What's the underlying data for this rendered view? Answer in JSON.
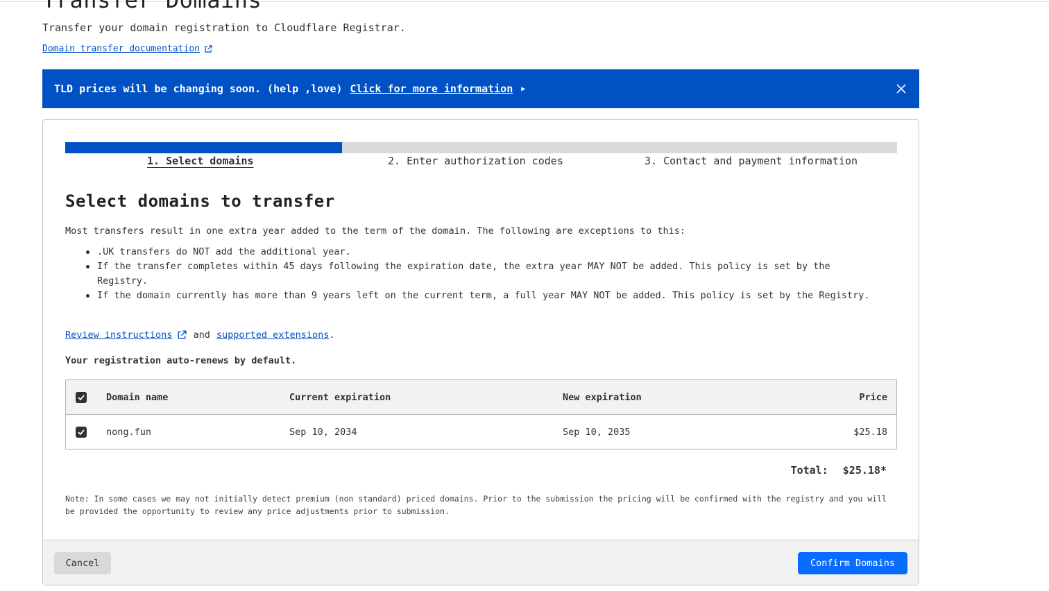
{
  "page": {
    "title": "Transfer Domains",
    "subtitle": "Transfer your domain registration to Cloudflare Registrar.",
    "doc_link": "Domain transfer documentation"
  },
  "banner": {
    "message": "TLD prices will be changing soon. (help ,love)",
    "link": "Click for more information",
    "bg_color": "#0051c3"
  },
  "wizard": {
    "progress": 0.333,
    "steps": [
      {
        "label": "1. Select domains",
        "active": true
      },
      {
        "label": "2. Enter authorization codes",
        "active": false
      },
      {
        "label": "3. Contact and payment information",
        "active": false
      }
    ]
  },
  "section": {
    "title": "Select domains to transfer",
    "intro": "Most transfers result in one extra year added to the term of the domain. The following are exceptions to this:",
    "exceptions": [
      ".UK transfers do NOT add the additional year.",
      "If the transfer completes within 45 days following the expiration date, the extra year MAY NOT be added. This policy is set by the Registry.",
      "If the domain currently has more than 9 years left on the current term, a full year MAY NOT be added. This policy is set by the Registry."
    ],
    "review_link": "Review instructions",
    "and_text": "and",
    "supported_link": "supported extensions",
    "period": ".",
    "autorenew": "Your registration auto-renews by default."
  },
  "table": {
    "headers": {
      "domain": "Domain name",
      "current": "Current expiration",
      "new": "New expiration",
      "price": "Price"
    },
    "rows": [
      {
        "domain": "nong.fun",
        "current": "Sep 10, 2034",
        "new": "Sep 10, 2035",
        "price": "$25.18",
        "checked": true
      }
    ]
  },
  "total": {
    "label": "Total:",
    "value": "$25.18*"
  },
  "note": "Note: In some cases we may not initially detect premium (non standard) priced domains. Prior to the submission the pricing will be confirmed with the registry and you will be provided the opportunity to review any price adjustments prior to submission.",
  "footer": {
    "cancel": "Cancel",
    "confirm": "Confirm Domains",
    "confirm_color": "#0a6cff"
  },
  "icons": {
    "external": "external-link-icon",
    "close": "close-icon",
    "caret": "caret-right-icon",
    "checkbox": "checkbox-checked-icon"
  }
}
